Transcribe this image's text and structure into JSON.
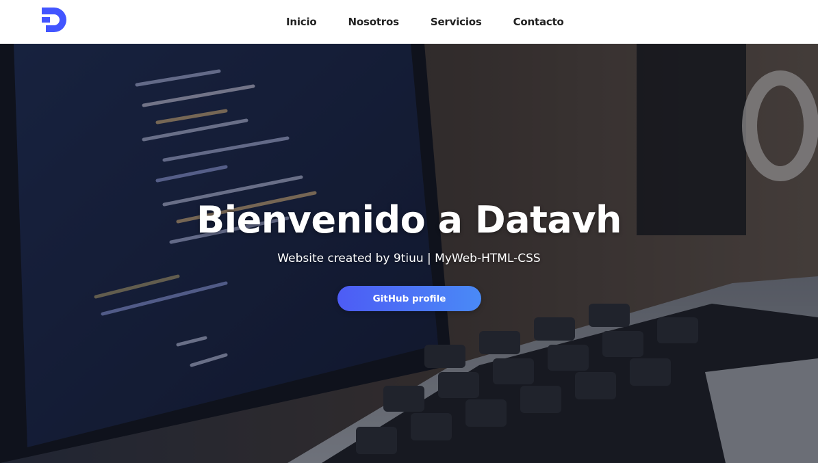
{
  "brand": {
    "logo_icon": "datavh-d-logo-icon",
    "accent_color": "#4255ff"
  },
  "nav": {
    "items": [
      {
        "label": "Inicio"
      },
      {
        "label": "Nosotros"
      },
      {
        "label": "Servicios"
      },
      {
        "label": "Contacto"
      }
    ]
  },
  "hero": {
    "background_image": "laptop-code-keyboard-photo",
    "title": "Bienvenido a Datavh",
    "subtitle": "Website created by 9tiuu | MyWeb-HTML-CSS",
    "cta_label": "GitHub profile",
    "cta_gradient": [
      "#4d5cf5",
      "#4a8af6"
    ]
  }
}
